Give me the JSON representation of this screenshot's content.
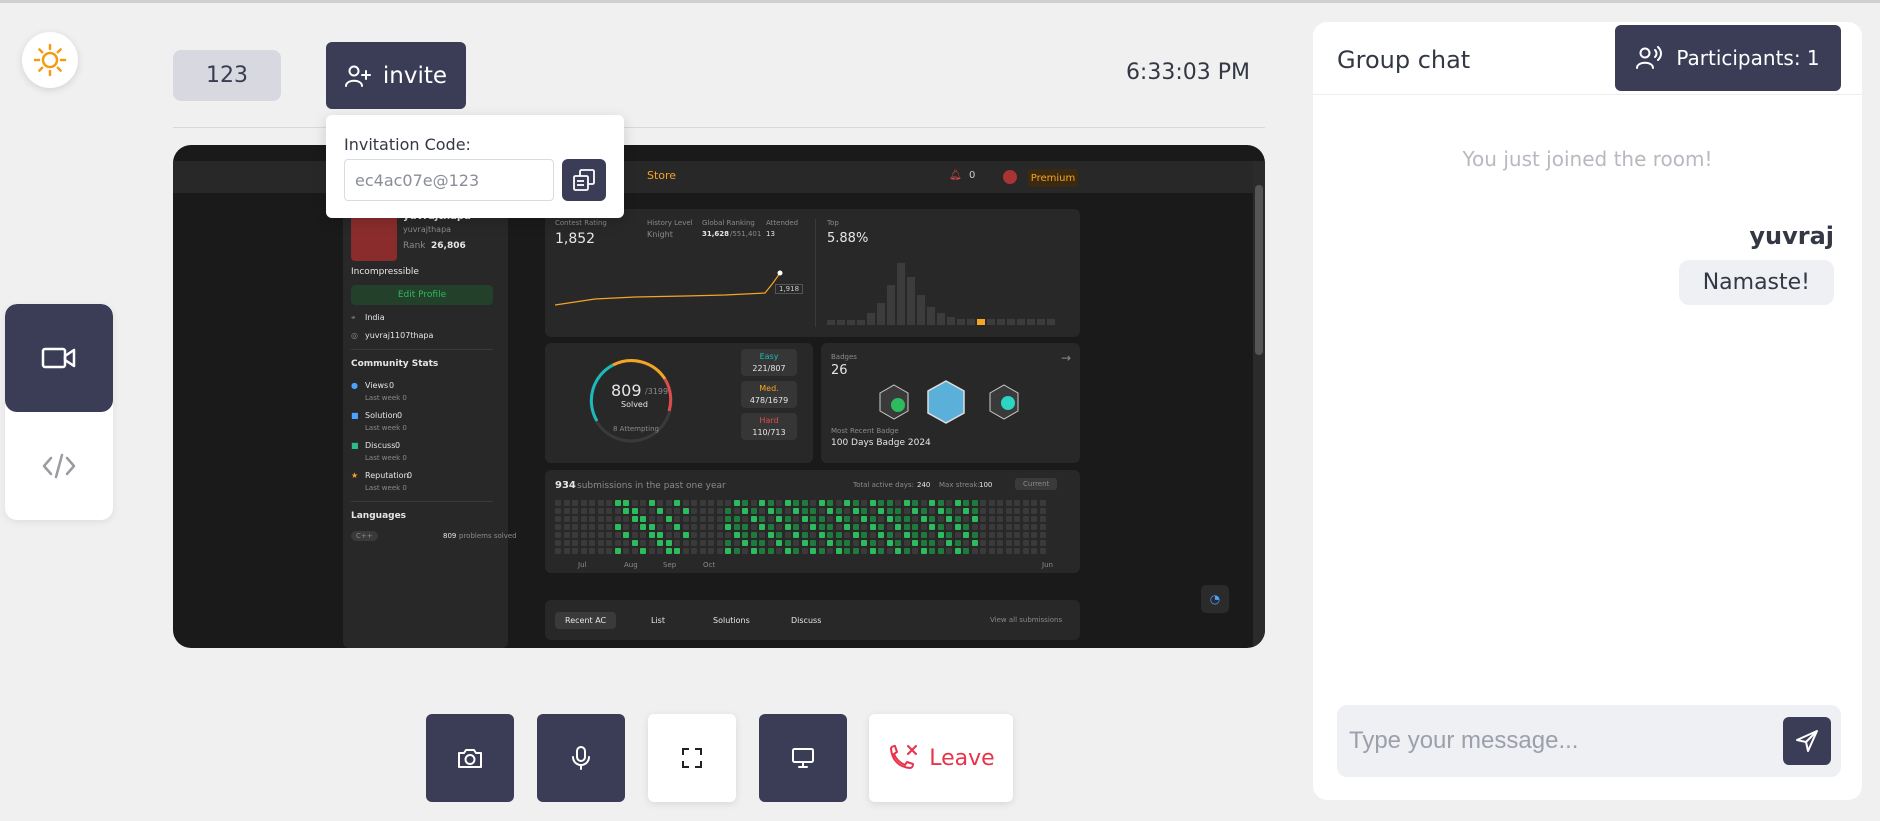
{
  "toolbar": {
    "room_id": "123",
    "invite_label": "invite",
    "clock": "6:33:03 PM"
  },
  "invite_popover": {
    "label": "Invitation Code:",
    "code": "ec4ac07e@123"
  },
  "controls": {
    "leave_label": "Leave"
  },
  "chat": {
    "title": "Group chat",
    "participants_label": "Participants: 1",
    "system_message": "You just joined the room!",
    "messages": [
      {
        "sender": "yuvraj",
        "text": "Namaste!"
      }
    ],
    "input_placeholder": "Type your message..."
  },
  "shared_screen": {
    "nav": {
      "store": "Store",
      "notif_count": "0",
      "premium": "Premium"
    },
    "profile": {
      "name": "yuvrajthapa",
      "handle": "yuvrajthapa",
      "rank_label": "Rank",
      "rank": "26,806",
      "bio": "Incompressible",
      "edit_label": "Edit Profile",
      "location": "India",
      "github": "yuvraj1107thapa"
    },
    "community": {
      "title": "Community Stats",
      "items": [
        {
          "label": "Views",
          "value": "0",
          "sub": "Last week 0"
        },
        {
          "label": "Solution",
          "value": "0",
          "sub": "Last week 0"
        },
        {
          "label": "Discuss",
          "value": "0",
          "sub": "Last week 0"
        },
        {
          "label": "Reputation",
          "value": "0",
          "sub": "Last week 0"
        }
      ]
    },
    "languages": {
      "title": "Languages",
      "lang": "C++",
      "count": "809",
      "count_label": "problems solved"
    },
    "contest": {
      "rating_label": "Contest Rating",
      "rating": "1,852",
      "history_label": "History Level",
      "history": "Knight",
      "global_label": "Global Ranking",
      "global": "31,628",
      "global_total": "/551,401",
      "attended_label": "Attended",
      "attended": "13",
      "point_label": "1,918",
      "top_label": "Top",
      "top": "5.88%"
    },
    "solved": {
      "count": "809",
      "total": "/3199",
      "label": "Solved",
      "attempting": "8 Attempting",
      "easy_label": "Easy",
      "easy": "221/807",
      "med_label": "Med.",
      "med": "478/1679",
      "hard_label": "Hard",
      "hard": "110/713"
    },
    "badges": {
      "label": "Badges",
      "count": "26",
      "recent_label": "Most Recent Badge",
      "recent": "100 Days Badge 2024"
    },
    "submissions": {
      "count": "934",
      "label": "submissions in the past one year",
      "active_label": "Total active days:",
      "active": "240",
      "streak_label": "Max streak:",
      "streak": "100",
      "current": "Current",
      "months": [
        "Jul",
        "Aug",
        "Sep",
        "Oct",
        "Jun"
      ]
    },
    "tabs": {
      "recent": "Recent AC",
      "list": "List",
      "solutions": "Solutions",
      "discuss": "Discuss",
      "view_all": "View all submissions"
    }
  },
  "colors": {
    "primary": "#3b3d57",
    "danger": "#e8334a",
    "accent_orange": "#f5a524"
  }
}
